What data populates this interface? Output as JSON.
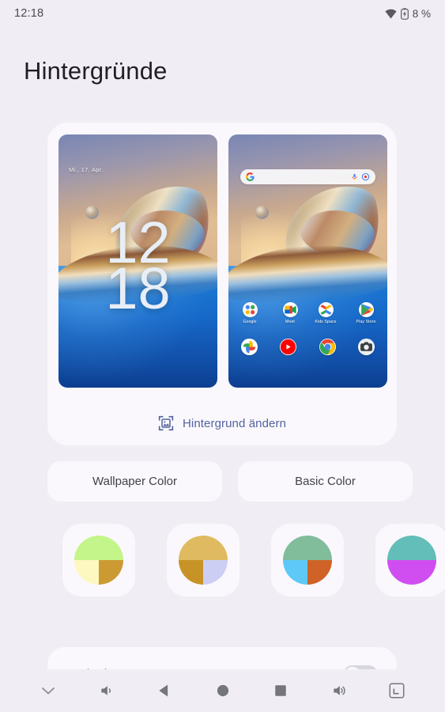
{
  "statusbar": {
    "time": "12:18",
    "wifi_icon": "wifi-icon",
    "battery_icon": "battery-charging-icon",
    "battery_percent": "8 %"
  },
  "header": {
    "title": "Hintergründe"
  },
  "preview": {
    "lockscreen": {
      "date": "Mi., 17. Apr.",
      "clock_hour": "12",
      "clock_minute": "18"
    },
    "homescreen": {
      "search_bar": {
        "google_icon": "google-g-icon",
        "mic_icon": "microphone-icon",
        "lens_icon": "google-lens-icon"
      },
      "apps_left": [
        {
          "label": "Google",
          "icon": "google-folder-icon"
        },
        {
          "label": "Meet",
          "icon": "google-meet-icon"
        }
      ],
      "apps_right": [
        {
          "label": "Kids Space",
          "icon": "kids-space-icon"
        },
        {
          "label": "Play Store",
          "icon": "play-store-icon"
        }
      ],
      "dock": [
        {
          "label": "Photos",
          "icon": "google-photos-icon"
        },
        {
          "label": "YouTube",
          "icon": "youtube-icon"
        },
        {
          "label": "Chrome",
          "icon": "chrome-icon"
        },
        {
          "label": "Camera",
          "icon": "camera-icon"
        }
      ]
    },
    "change_wallpaper": {
      "label": "Hintergrund ändern",
      "icon": "image-frame-icon",
      "color": "#53639e"
    }
  },
  "tabs": [
    {
      "label": "Wallpaper Color",
      "selected": true
    },
    {
      "label": "Basic Color",
      "selected": false
    }
  ],
  "color_swatches": [
    {
      "name": "swatch-green-yellow",
      "top": "#c4f58a",
      "bottom_left": "#fcf8c0",
      "bottom_right": "#cc9a33"
    },
    {
      "name": "swatch-gold-lavender",
      "top": "#e0ba60",
      "bottom_left": "#c79327",
      "bottom_right": "#cdcef4"
    },
    {
      "name": "swatch-green-blue-orange",
      "top": "#81bd9b",
      "bottom_left": "#5ec9f7",
      "bottom_right": "#cf6327"
    },
    {
      "name": "swatch-teal-magenta",
      "top": "#63bdb8",
      "bottom_left": "#d04ef0",
      "bottom_right": "#d04ef0"
    }
  ],
  "dark_theme": {
    "label": "Dark Theme",
    "enabled": false
  },
  "navbar": {
    "buttons": [
      {
        "name": "collapse-chevron-down",
        "icon": "chevron-down-icon"
      },
      {
        "name": "volume-down",
        "icon": "volume-down-icon"
      },
      {
        "name": "back",
        "icon": "back-triangle-icon"
      },
      {
        "name": "home",
        "icon": "home-circle-icon"
      },
      {
        "name": "recents",
        "icon": "square-icon"
      },
      {
        "name": "volume-up",
        "icon": "volume-up-icon"
      },
      {
        "name": "fullscreen",
        "icon": "fullscreen-icon"
      }
    ]
  },
  "theme": {
    "background": "#f0eef4",
    "card": "#faf8fc",
    "accent": "#53639e",
    "text": "#1f1f24"
  }
}
